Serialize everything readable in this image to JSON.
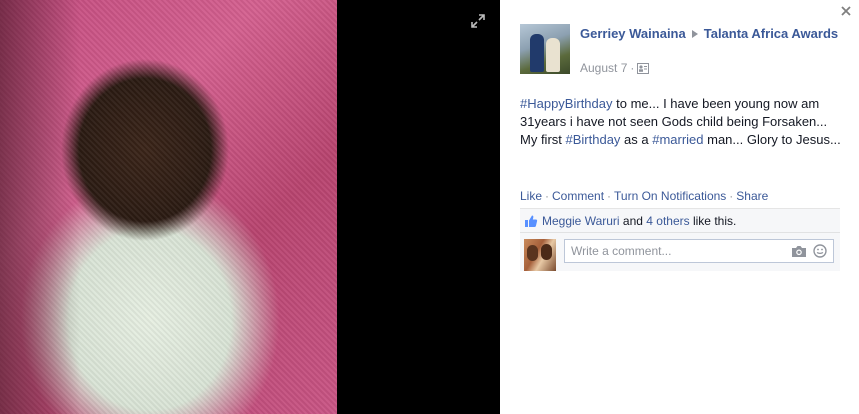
{
  "viewer": {
    "photo_alt": "Baby photo",
    "expand_icon": "expand-icon",
    "close_icon": "close-icon"
  },
  "post": {
    "author": "Gerriey Wainaina",
    "target": "Talanta Africa Awards",
    "date": "August 7",
    "separator": "·",
    "audience_icon": "group-audience-icon",
    "text_segments": [
      {
        "type": "hashtag",
        "text": "#HappyBirthday"
      },
      {
        "type": "text",
        "text": " to me... I have been young now am 31years i have not seen Gods child being Forsaken... My first "
      },
      {
        "type": "hashtag",
        "text": "#Birthday"
      },
      {
        "type": "text",
        "text": " as a "
      },
      {
        "type": "hashtag",
        "text": "#married"
      },
      {
        "type": "text",
        "text": " man... Glory to Jesus..."
      }
    ]
  },
  "actions": {
    "like": "Like",
    "comment": "Comment",
    "notifications": "Turn On Notifications",
    "share": "Share",
    "separator": "·"
  },
  "likes": {
    "icon": "thumbs-up-icon",
    "first_name": "Meggie Waruri",
    "and": " and ",
    "others": "4 others",
    "suffix": " like this."
  },
  "comment_box": {
    "placeholder": "Write a comment...",
    "camera_icon": "camera-icon",
    "emoji_icon": "smiley-icon"
  },
  "colors": {
    "link": "#3b5998",
    "muted": "#90949c",
    "text": "#141823",
    "ufi_bg": "#f6f7f9"
  }
}
